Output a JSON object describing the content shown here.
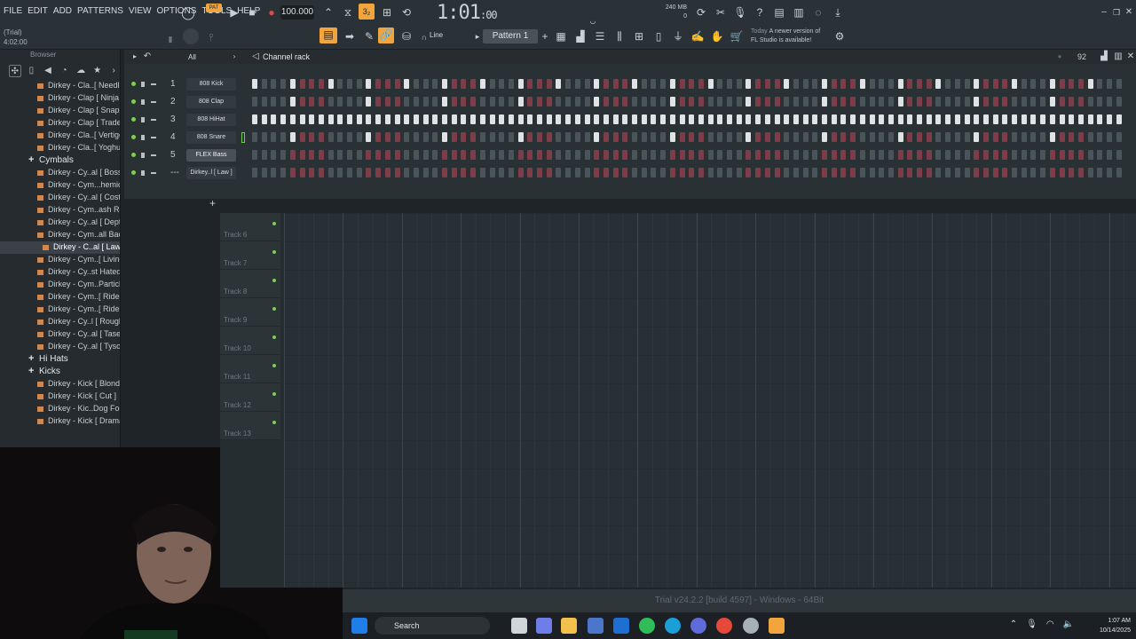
{
  "menu": [
    "FILE",
    "EDIT",
    "ADD",
    "PATTERNS",
    "VIEW",
    "OPTIONS",
    "TOOLS",
    "HELP"
  ],
  "trial_label": "(Trial)",
  "position_label": "4:02:00",
  "pat_label": "PAT",
  "tempo": "100.000",
  "time_display": "1:01",
  "time_sub": ":00",
  "cpu_label": "240 MB",
  "cpu_sub": "0",
  "pattern_label": "Pattern 1",
  "snap_label": "Line",
  "news": {
    "today": "Today",
    "line1": "A newer version of",
    "line2": "FL Studio is available!"
  },
  "browser": {
    "title": "Browser",
    "items": [
      {
        "type": "file",
        "label": "Dirkey - Cla..[ Needle ]"
      },
      {
        "type": "file",
        "label": "Dirkey - Clap [ Ninja ]"
      },
      {
        "type": "file",
        "label": "Dirkey - Clap [ Snap ]"
      },
      {
        "type": "file",
        "label": "Dirkey - Clap [ Trade ]"
      },
      {
        "type": "file",
        "label": "Dirkey - Cla..[ Vertigo ]"
      },
      {
        "type": "file",
        "label": "Dirkey - Cla..[ Yoghurt ]"
      },
      {
        "type": "folder",
        "label": "Cymbals"
      },
      {
        "type": "file",
        "label": "Dirkey - Cy..al [ Boss ]"
      },
      {
        "type": "file",
        "label": "Dirkey - Cym...hemical ]"
      },
      {
        "type": "file",
        "label": "Dirkey - Cy..al [ Cost ]"
      },
      {
        "type": "file",
        "label": "Dirkey - Cym..ash Roll ]"
      },
      {
        "type": "file",
        "label": "Dirkey - Cy..al [ Dept ]"
      },
      {
        "type": "file",
        "label": "Dirkey - Cym..all Back ]"
      },
      {
        "type": "selected",
        "label": "Dirkey - C..al [ Law ]"
      },
      {
        "type": "file",
        "label": "Dirkey - Cym..[ Living ]"
      },
      {
        "type": "file",
        "label": "Dirkey - Cy..st Hated ]"
      },
      {
        "type": "file",
        "label": "Dirkey - Cym..Particle ]"
      },
      {
        "type": "file",
        "label": "Dirkey - Cym..[ Ride 1 ]"
      },
      {
        "type": "file",
        "label": "Dirkey - Cym..[ Ride 2 ]"
      },
      {
        "type": "file",
        "label": "Dirkey - Cy..l [ Rough ]"
      },
      {
        "type": "file",
        "label": "Dirkey - Cy..al [ Taser ]"
      },
      {
        "type": "file",
        "label": "Dirkey - Cy..al [ Tyson ]"
      },
      {
        "type": "folder",
        "label": "Hi Hats"
      },
      {
        "type": "folder",
        "label": "Kicks"
      },
      {
        "type": "file",
        "label": "Dirkey - Kick [ Blonde ]"
      },
      {
        "type": "file",
        "label": "Dirkey - Kick [ Cut ]"
      },
      {
        "type": "file",
        "label": "Dirkey - Kic..Dog Food ]"
      },
      {
        "type": "file",
        "label": "Dirkey - Kick [ Drama ]"
      }
    ]
  },
  "channel_rack": {
    "title": "Channel rack",
    "filter": "All",
    "swing": "92",
    "channels": [
      {
        "num": "1",
        "name": "808 Kick",
        "pattern": "1000100010001000"
      },
      {
        "num": "2",
        "name": "808 Clap",
        "pattern": "0000100000001000"
      },
      {
        "num": "3",
        "name": "808 HiHat",
        "pattern": "1111111111111111"
      },
      {
        "num": "4",
        "name": "808 Snare",
        "pattern": "0000100000001000"
      },
      {
        "num": "5",
        "name": "FLEX Bass",
        "pattern": "0000000000000000"
      },
      {
        "num": "---",
        "name": "Dirkey..l [ Law ]",
        "pattern": "0000000000000000"
      }
    ]
  },
  "playlist": {
    "tracks": [
      "Track 6",
      "Track 7",
      "Track 8",
      "Track 9",
      "Track 10",
      "Track 11",
      "Track 12",
      "Track 13"
    ]
  },
  "status_text": "Trial v24.2.2 [build 4597] - Windows - 64Bit",
  "taskbar": {
    "search_label": "Search",
    "time": "1:07 AM",
    "date": "10/14/2025"
  },
  "colors": {
    "accent": "#f2a53c",
    "led": "#7fcf4e",
    "step_alt": "#7d3c47"
  }
}
